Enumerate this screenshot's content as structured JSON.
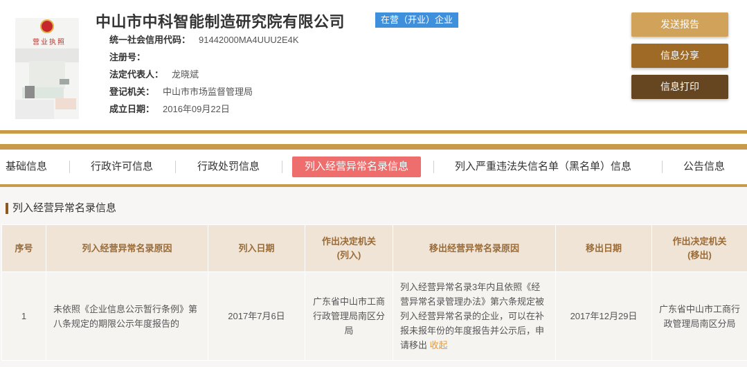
{
  "company": {
    "name": "中山市中科智能制造研究院有限公司",
    "status": "在营（开业）企业",
    "license_title": "营业执照"
  },
  "info": [
    {
      "label": "统一社会信用代码：",
      "value": "91442000MA4UUU2E4K"
    },
    {
      "label": "注册号：",
      "value": ""
    },
    {
      "label": "法定代表人：",
      "value": "龙晓斌"
    },
    {
      "label": "登记机关：",
      "value": "中山市市场监督管理局"
    },
    {
      "label": "成立日期：",
      "value": "2016年09月22日"
    }
  ],
  "actions": {
    "send": "发送报告",
    "share": "信息分享",
    "print": "信息打印"
  },
  "tabs": [
    {
      "label": "基础信息"
    },
    {
      "label": "行政许可信息"
    },
    {
      "label": "行政处罚信息"
    },
    {
      "label": "列入经营异常名录信息"
    },
    {
      "label": "列入严重违法失信名单（黑名单）信息"
    },
    {
      "label": "公告信息"
    }
  ],
  "section": {
    "title": "列入经营异常名录信息",
    "columns": {
      "no": "序号",
      "reason": "列入经营异常名录原因",
      "date_in": "列入日期",
      "org_in_1": "作出决定机关",
      "org_in_2": "(列入)",
      "reason_out": "移出经营异常名录原因",
      "date_out": "移出日期",
      "org_out_1": "作出决定机关",
      "org_out_2": "(移出)"
    },
    "rows": [
      {
        "no": "1",
        "reason": "未依照《企业信息公示暂行条例》第八条规定的期限公示年度报告的",
        "date_in": "2017年7月6日",
        "org_in": "广东省中山市工商行政管理局南区分局",
        "reason_out": "列入经营异常名录3年内且依照《经营异常名录管理办法》第六条规定被列入经营异常名录的企业，可以在补报未报年份的年度报告并公示后，申请移出",
        "collapse": "收起",
        "date_out": "2017年12月29日",
        "org_out": "广东省中山市工商行政管理局南区分局"
      }
    ]
  },
  "colors": {
    "gold": "#c89b4a",
    "active_tab": "#ee6e6e",
    "badge": "#3e8fdc",
    "btn_send": "#d0a25a",
    "btn_share": "#9e6a26",
    "btn_print": "#664620",
    "header_cell": "#efe4d6"
  }
}
